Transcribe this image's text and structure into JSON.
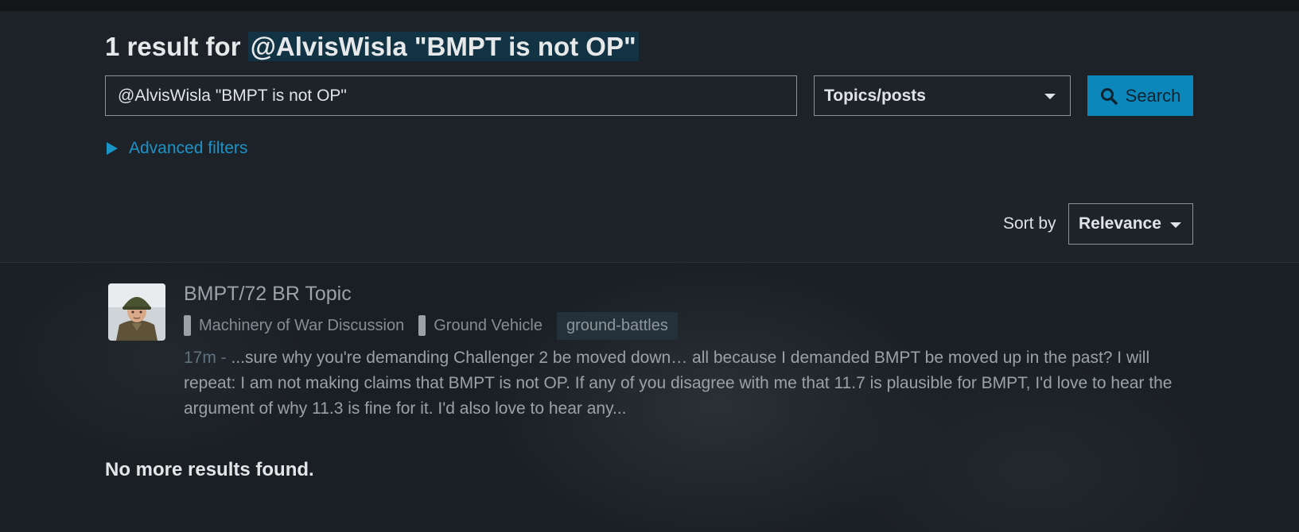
{
  "search": {
    "title_prefix": "1 result for",
    "title_query": "@AlvisWisla \"BMPT is not OP\"",
    "query_value": "@AlvisWisla \"BMPT is not OP\"",
    "type_selected": "Topics/posts",
    "button_label": "Search",
    "advanced_filters_label": "Advanced filters"
  },
  "sort": {
    "label": "Sort by",
    "selected": "Relevance"
  },
  "results": [
    {
      "title": "BMPT/72 BR Topic",
      "categories": [
        "Machinery of War Discussion",
        "Ground Vehicle"
      ],
      "tag": "ground-battles",
      "date": "17m -",
      "blurb": "...sure why you're demanding Challenger 2 be moved down… all because I demanded BMPT be moved up in the past? I will repeat: I am not making claims that BMPT is not OP. If any of you disagree with me that 11.7 is plausible for BMPT, I'd love to hear the argument of why 11.3 is fine for it. I'd also love to hear any..."
    }
  ],
  "no_more_results": "No more results found.",
  "colors": {
    "accent": "#0b87bb",
    "link": "#1a93c7",
    "highlight": "#123343",
    "background": "#1b2025"
  },
  "icons": {
    "search": "search-icon",
    "caret": "chevron-down-icon",
    "expand": "triangle-right-icon"
  }
}
